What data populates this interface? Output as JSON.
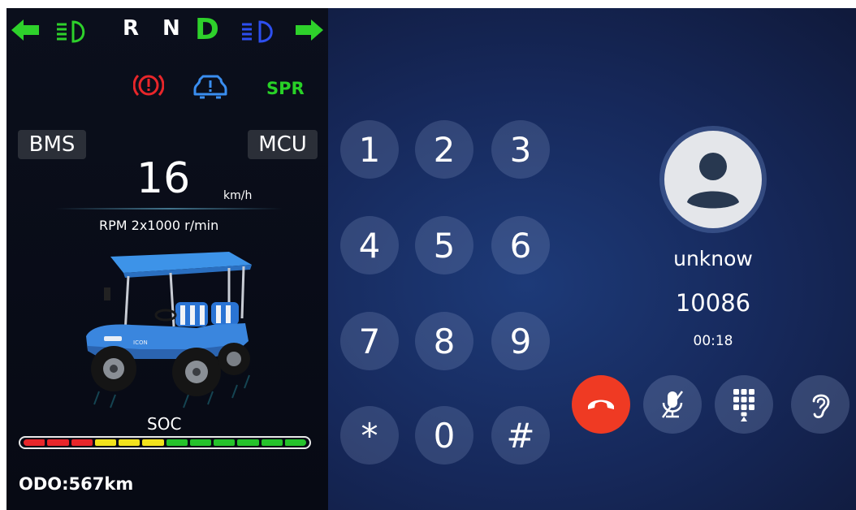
{
  "status_bar": {
    "gear_r": "R",
    "gear_n": "N",
    "gear_d": "D",
    "colors": {
      "arrow": "#2ed12b",
      "low_beam": "#2ed12b",
      "high_beam": "#2d4ff0",
      "gear_active": "#2ed12b"
    }
  },
  "warnings": {
    "brake_color": "#e8262a",
    "tpms_color": "#3a8ef0",
    "spr_label": "SPR",
    "spr_color": "#28d127"
  },
  "dashboard": {
    "bms_label": "BMS",
    "mcu_label": "MCU",
    "speed": "16",
    "speed_unit": "km/h",
    "rpm_text": "RPM 2x1000 r/min",
    "soc_label": "SOC",
    "soc_level": 1.0,
    "soc_segments": [
      "#e8262a",
      "#e8262a",
      "#e8262a",
      "#f2e21c",
      "#f2e21c",
      "#f2e21c",
      "#26c22b",
      "#26c22b",
      "#26c22b",
      "#26c22b",
      "#26c22b",
      "#26c22b"
    ],
    "odo": "ODO:567km",
    "vehicle_icon": "golf-cart-image"
  },
  "keypad": {
    "keys": [
      "1",
      "2",
      "3",
      "4",
      "5",
      "6",
      "7",
      "8",
      "9",
      "*",
      "0",
      "#"
    ]
  },
  "call": {
    "caller_name": "unknow",
    "number": "10086",
    "duration": "00:18",
    "controls": [
      "hang-up-icon",
      "mute-microphone-icon",
      "dialpad-icon",
      "earpiece-icon"
    ]
  }
}
